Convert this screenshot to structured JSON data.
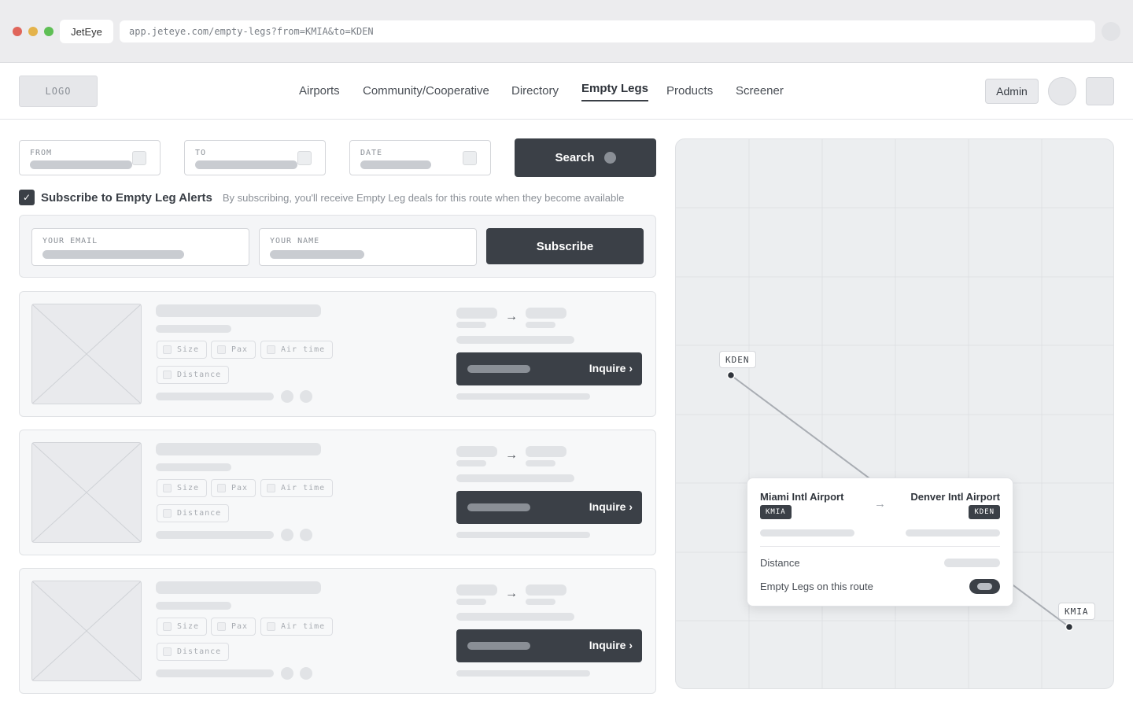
{
  "browser": {
    "tab_title": "JetEye",
    "url": "app.jeteye.com/empty-legs?from=KMIA&to=KDEN",
    "traffic_lights": [
      "#e0655a",
      "#e4b34b",
      "#5fbf55"
    ]
  },
  "navbar": {
    "logo": "LOGO",
    "links": [
      "Airports",
      "Community/Cooperative",
      "Directory",
      "Empty Legs",
      "Products",
      "Screener"
    ],
    "active": "Empty Legs",
    "admin_label": "Admin"
  },
  "search": {
    "from_label": "FROM",
    "to_label": "TO",
    "date_label": "DATE",
    "button_label": "Search"
  },
  "subscribe": {
    "checked": true,
    "title": "Subscribe to Empty Leg Alerts",
    "description": "By subscribing, you'll receive Empty Leg deals for this route when they become available",
    "email_label": "YOUR EMAIL",
    "name_label": "YOUR NAME",
    "button_label": "Subscribe"
  },
  "results": {
    "chips": [
      "Size",
      "Pax",
      "Air time",
      "Distance"
    ],
    "inquire_label": "Inquire ›",
    "count": 3
  },
  "map": {
    "origin": {
      "code": "KMIA",
      "name": "Miami Intl Airport"
    },
    "destination": {
      "code": "KDEN",
      "name": "Denver Intl Airport"
    },
    "popup": {
      "distance_label": "Distance",
      "legs_label": "Empty Legs on this route"
    }
  }
}
